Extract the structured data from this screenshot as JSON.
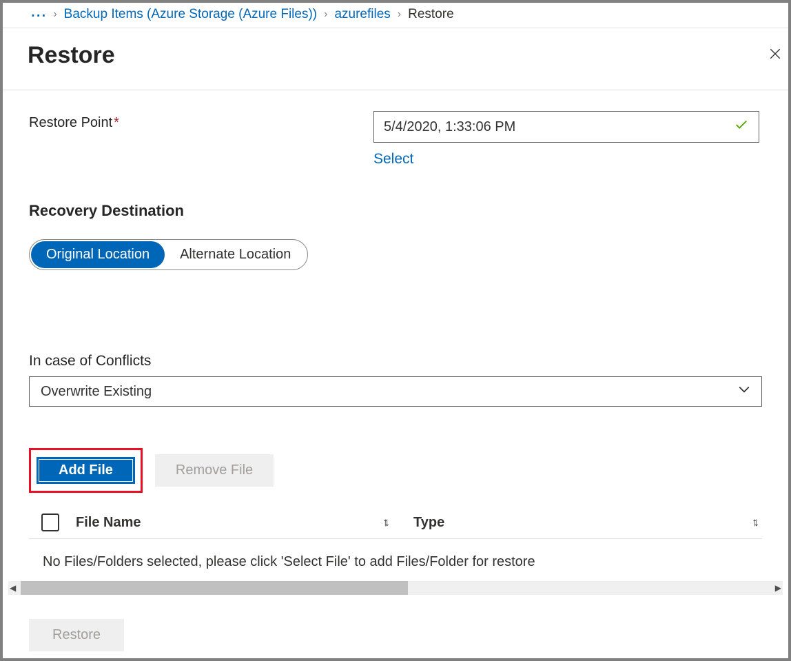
{
  "breadcrumb": {
    "ellipsis": "...",
    "items": [
      {
        "label": "Backup Items (Azure Storage (Azure Files))",
        "link": true
      },
      {
        "label": "azurefiles",
        "link": true
      },
      {
        "label": "Restore",
        "link": false
      }
    ]
  },
  "page_title": "Restore",
  "restore_point": {
    "label": "Restore Point",
    "value": "5/4/2020, 1:33:06 PM",
    "select_link": "Select"
  },
  "recovery_destination": {
    "header": "Recovery Destination",
    "options": {
      "original": "Original Location",
      "alternate": "Alternate Location"
    }
  },
  "conflicts": {
    "label": "In case of Conflicts",
    "selected": "Overwrite Existing"
  },
  "file_actions": {
    "add": "Add File",
    "remove": "Remove File"
  },
  "table": {
    "filename_header": "File Name",
    "type_header": "Type",
    "empty_message": "No Files/Folders selected, please click 'Select File' to add Files/Folder for restore"
  },
  "footer": {
    "restore_button": "Restore"
  }
}
